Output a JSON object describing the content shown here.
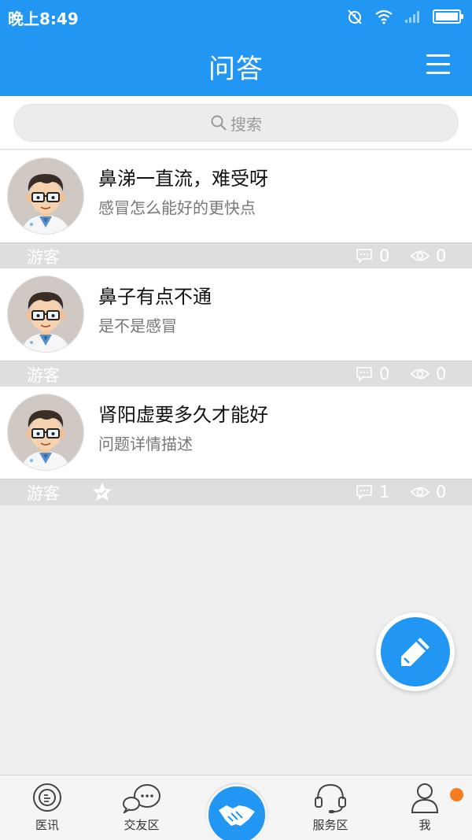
{
  "status_bar": {
    "time": "晚上8:49"
  },
  "header": {
    "title": "问答",
    "menu_icon": "menu-icon"
  },
  "search": {
    "placeholder": "搜索"
  },
  "questions": [
    {
      "title": "鼻涕一直流，难受呀",
      "description": "感冒怎么能好的更快点",
      "user": "游客",
      "comments": "0",
      "views": "0",
      "verified": false
    },
    {
      "title": "鼻子有点不通",
      "description": "是不是感冒",
      "user": "游客",
      "comments": "0",
      "views": "0",
      "verified": false
    },
    {
      "title": "肾阳虚要多久才能好",
      "description": "问题详情描述",
      "user": "游客",
      "comments": "1",
      "views": "0",
      "verified": true
    }
  ],
  "bottom_nav": {
    "items": [
      {
        "label": "医讯",
        "icon": "news-icon"
      },
      {
        "label": "交友区",
        "icon": "chat-icon"
      },
      {
        "label": "",
        "icon": "handshake-icon"
      },
      {
        "label": "服务区",
        "icon": "headset-icon"
      },
      {
        "label": "我",
        "icon": "user-icon"
      }
    ]
  },
  "colors": {
    "primary": "#2196f3",
    "notification": "#f57c1f"
  }
}
